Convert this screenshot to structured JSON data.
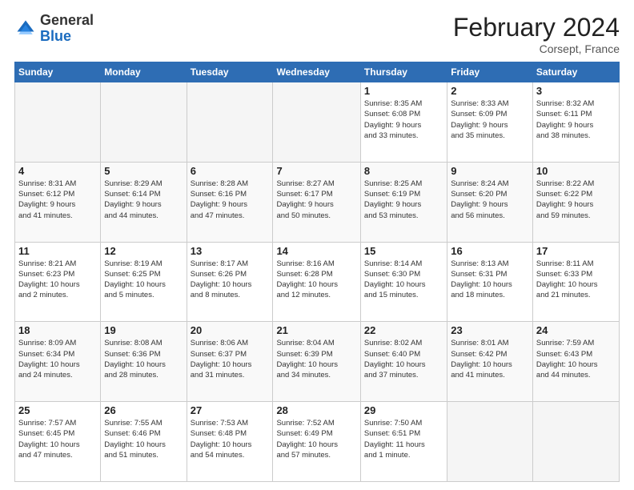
{
  "header": {
    "logo_general": "General",
    "logo_blue": "Blue",
    "month_title": "February 2024",
    "location": "Corsept, France"
  },
  "days_of_week": [
    "Sunday",
    "Monday",
    "Tuesday",
    "Wednesday",
    "Thursday",
    "Friday",
    "Saturday"
  ],
  "weeks": [
    [
      {
        "day": "",
        "info": "",
        "empty": true
      },
      {
        "day": "",
        "info": "",
        "empty": true
      },
      {
        "day": "",
        "info": "",
        "empty": true
      },
      {
        "day": "",
        "info": "",
        "empty": true
      },
      {
        "day": "1",
        "info": "Sunrise: 8:35 AM\nSunset: 6:08 PM\nDaylight: 9 hours\nand 33 minutes."
      },
      {
        "day": "2",
        "info": "Sunrise: 8:33 AM\nSunset: 6:09 PM\nDaylight: 9 hours\nand 35 minutes."
      },
      {
        "day": "3",
        "info": "Sunrise: 8:32 AM\nSunset: 6:11 PM\nDaylight: 9 hours\nand 38 minutes."
      }
    ],
    [
      {
        "day": "4",
        "info": "Sunrise: 8:31 AM\nSunset: 6:12 PM\nDaylight: 9 hours\nand 41 minutes."
      },
      {
        "day": "5",
        "info": "Sunrise: 8:29 AM\nSunset: 6:14 PM\nDaylight: 9 hours\nand 44 minutes."
      },
      {
        "day": "6",
        "info": "Sunrise: 8:28 AM\nSunset: 6:16 PM\nDaylight: 9 hours\nand 47 minutes."
      },
      {
        "day": "7",
        "info": "Sunrise: 8:27 AM\nSunset: 6:17 PM\nDaylight: 9 hours\nand 50 minutes."
      },
      {
        "day": "8",
        "info": "Sunrise: 8:25 AM\nSunset: 6:19 PM\nDaylight: 9 hours\nand 53 minutes."
      },
      {
        "day": "9",
        "info": "Sunrise: 8:24 AM\nSunset: 6:20 PM\nDaylight: 9 hours\nand 56 minutes."
      },
      {
        "day": "10",
        "info": "Sunrise: 8:22 AM\nSunset: 6:22 PM\nDaylight: 9 hours\nand 59 minutes."
      }
    ],
    [
      {
        "day": "11",
        "info": "Sunrise: 8:21 AM\nSunset: 6:23 PM\nDaylight: 10 hours\nand 2 minutes."
      },
      {
        "day": "12",
        "info": "Sunrise: 8:19 AM\nSunset: 6:25 PM\nDaylight: 10 hours\nand 5 minutes."
      },
      {
        "day": "13",
        "info": "Sunrise: 8:17 AM\nSunset: 6:26 PM\nDaylight: 10 hours\nand 8 minutes."
      },
      {
        "day": "14",
        "info": "Sunrise: 8:16 AM\nSunset: 6:28 PM\nDaylight: 10 hours\nand 12 minutes."
      },
      {
        "day": "15",
        "info": "Sunrise: 8:14 AM\nSunset: 6:30 PM\nDaylight: 10 hours\nand 15 minutes."
      },
      {
        "day": "16",
        "info": "Sunrise: 8:13 AM\nSunset: 6:31 PM\nDaylight: 10 hours\nand 18 minutes."
      },
      {
        "day": "17",
        "info": "Sunrise: 8:11 AM\nSunset: 6:33 PM\nDaylight: 10 hours\nand 21 minutes."
      }
    ],
    [
      {
        "day": "18",
        "info": "Sunrise: 8:09 AM\nSunset: 6:34 PM\nDaylight: 10 hours\nand 24 minutes."
      },
      {
        "day": "19",
        "info": "Sunrise: 8:08 AM\nSunset: 6:36 PM\nDaylight: 10 hours\nand 28 minutes."
      },
      {
        "day": "20",
        "info": "Sunrise: 8:06 AM\nSunset: 6:37 PM\nDaylight: 10 hours\nand 31 minutes."
      },
      {
        "day": "21",
        "info": "Sunrise: 8:04 AM\nSunset: 6:39 PM\nDaylight: 10 hours\nand 34 minutes."
      },
      {
        "day": "22",
        "info": "Sunrise: 8:02 AM\nSunset: 6:40 PM\nDaylight: 10 hours\nand 37 minutes."
      },
      {
        "day": "23",
        "info": "Sunrise: 8:01 AM\nSunset: 6:42 PM\nDaylight: 10 hours\nand 41 minutes."
      },
      {
        "day": "24",
        "info": "Sunrise: 7:59 AM\nSunset: 6:43 PM\nDaylight: 10 hours\nand 44 minutes."
      }
    ],
    [
      {
        "day": "25",
        "info": "Sunrise: 7:57 AM\nSunset: 6:45 PM\nDaylight: 10 hours\nand 47 minutes."
      },
      {
        "day": "26",
        "info": "Sunrise: 7:55 AM\nSunset: 6:46 PM\nDaylight: 10 hours\nand 51 minutes."
      },
      {
        "day": "27",
        "info": "Sunrise: 7:53 AM\nSunset: 6:48 PM\nDaylight: 10 hours\nand 54 minutes."
      },
      {
        "day": "28",
        "info": "Sunrise: 7:52 AM\nSunset: 6:49 PM\nDaylight: 10 hours\nand 57 minutes."
      },
      {
        "day": "29",
        "info": "Sunrise: 7:50 AM\nSunset: 6:51 PM\nDaylight: 11 hours\nand 1 minute."
      },
      {
        "day": "",
        "info": "",
        "empty": true
      },
      {
        "day": "",
        "info": "",
        "empty": true
      }
    ]
  ]
}
